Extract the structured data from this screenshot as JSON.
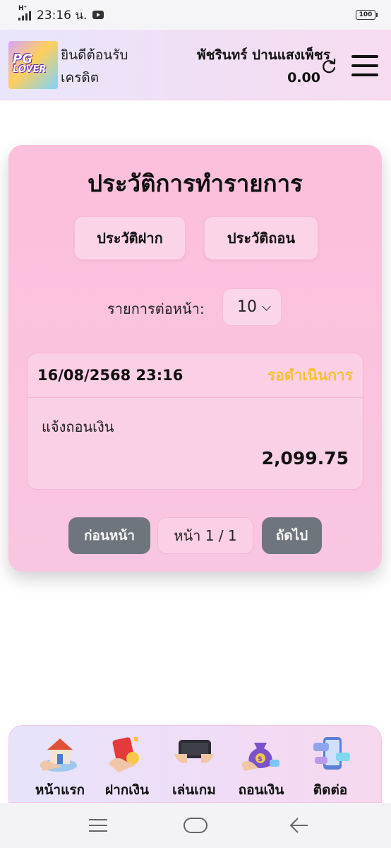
{
  "status_bar": {
    "network": "H⁺",
    "time": "23:16 น.",
    "battery": "100",
    "icons": [
      "signal-icon",
      "youtube-icon",
      "battery-icon"
    ]
  },
  "header": {
    "logo_text_line1": "PG",
    "logo_text_line2": "LOVER",
    "welcome_line1": "ยินดีต้อนรับ",
    "welcome_line2": "เครดิต",
    "user_name": "พัชรินทร์ ปานแสงเพ็ชร",
    "credit": "0.00",
    "icons": [
      "refresh-icon",
      "menu-icon"
    ]
  },
  "history": {
    "title": "ประวัติการทำรายการ",
    "tab_deposit": "ประวัติฝาก",
    "tab_withdraw": "ประวัติถอน",
    "per_page_label": "รายการต่อหน้า:",
    "per_page_value": "10",
    "transactions": [
      {
        "datetime": "16/08/2568 23:16",
        "status": "รอดำเนินการ",
        "type": "แจ้งถอนเงิน",
        "amount": "2,099.75"
      }
    ],
    "pagination": {
      "prev_label": "ก่อนหน้า",
      "page_info": "หน้า 1 / 1",
      "next_label": "ถัดไป"
    }
  },
  "bottom_nav": {
    "items": [
      {
        "label": "หน้าแรก",
        "icon": "home-icon"
      },
      {
        "label": "ฝากเงิน",
        "icon": "deposit-icon"
      },
      {
        "label": "เล่นเกม",
        "icon": "play-game-icon"
      },
      {
        "label": "ถอนเงิน",
        "icon": "withdraw-icon"
      },
      {
        "label": "ติดต่อ",
        "icon": "contact-icon"
      }
    ]
  },
  "colors": {
    "card_bg": "#fbc3df",
    "status_pending": "#f7c22b",
    "pager_button": "#6e757c",
    "header_bg": "#f1dff5"
  }
}
